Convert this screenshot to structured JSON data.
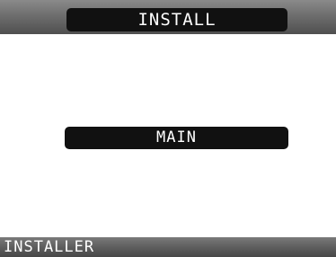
{
  "header": {
    "title": "INSTALL"
  },
  "menu": {
    "items": [
      {
        "label": "MAIN",
        "selected": true
      }
    ]
  },
  "footer": {
    "label": "INSTALLER"
  },
  "colors": {
    "background": "#ffffff",
    "bar_gray": "#6e6e6e",
    "pill_black": "#111111",
    "text_white": "#ffffff"
  }
}
